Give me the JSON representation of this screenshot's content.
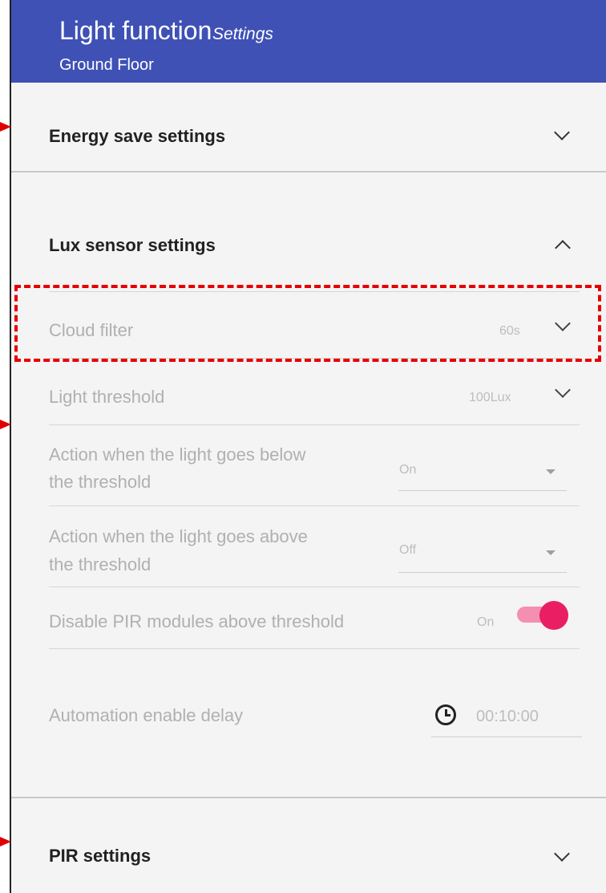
{
  "header": {
    "title": "Light function",
    "subtitle": "Settings",
    "location": "Ground Floor"
  },
  "sections": {
    "energy": {
      "label": "Energy save settings"
    },
    "lux": {
      "label": "Lux sensor settings"
    },
    "pir": {
      "label": "PIR settings"
    }
  },
  "lux_rows": {
    "cloud_filter": {
      "label": "Cloud filter",
      "value": "60s"
    },
    "light_threshold": {
      "label": "Light threshold",
      "value": "100Lux"
    },
    "below": {
      "label_line1": "Action when the light goes below",
      "label_line2": "the threshold",
      "value": "On"
    },
    "above": {
      "label_line1": "Action when the light goes above",
      "label_line2": "the threshold",
      "value": "Off"
    },
    "disable_pir": {
      "label": "Disable PIR modules above threshold",
      "value": "On"
    },
    "automation_delay": {
      "label": "Automation enable delay",
      "value": "00:10:00"
    }
  },
  "colors": {
    "header": "#3f51b5",
    "toggle": "#e91e63",
    "highlight": "#e60000"
  }
}
